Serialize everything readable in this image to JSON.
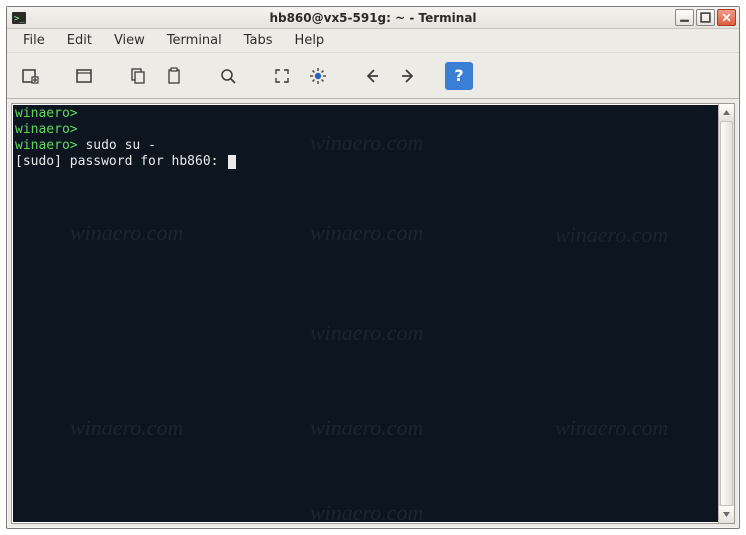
{
  "window": {
    "title": "hb860@vx5-591g: ~ - Terminal"
  },
  "menubar": {
    "items": [
      "File",
      "Edit",
      "View",
      "Terminal",
      "Tabs",
      "Help"
    ]
  },
  "toolbar": {
    "icons": [
      "new-tab-icon",
      "new-window-icon",
      "copy-icon",
      "paste-icon",
      "search-icon",
      "fullscreen-icon",
      "settings-icon",
      "back-icon",
      "forward-icon",
      "help-icon"
    ],
    "help_label": "?"
  },
  "terminal": {
    "lines": [
      {
        "prompt": "winaero",
        "sep": ">",
        "command": ""
      },
      {
        "prompt": "winaero",
        "sep": ">",
        "command": ""
      },
      {
        "prompt": "winaero",
        "sep": ">",
        "command": " sudo su -"
      }
    ],
    "sudo_line": "[sudo] password for hb860: "
  },
  "watermark": "winaero.com"
}
